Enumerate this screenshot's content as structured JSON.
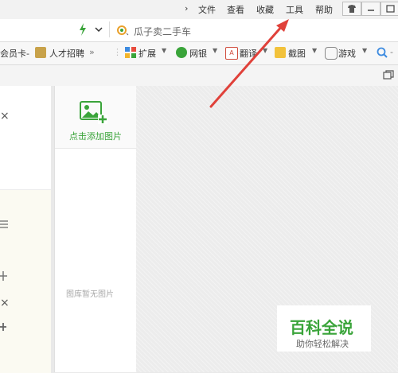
{
  "menu": {
    "items": [
      "文件",
      "查看",
      "收藏",
      "工具",
      "帮助"
    ]
  },
  "address": {
    "search_text": "瓜子卖二手车"
  },
  "bookmarks": [
    {
      "label": "会员卡-",
      "icon": "card-icon"
    },
    {
      "label": "人才招聘",
      "icon": "recruit-icon"
    },
    {
      "label": "扩展",
      "icon": "extension-icon"
    },
    {
      "label": "网银",
      "icon": "bank-shield-icon"
    },
    {
      "label": "翻译",
      "icon": "translate-icon"
    },
    {
      "label": "截图",
      "icon": "screenshot-icon"
    },
    {
      "label": "游戏",
      "icon": "game-icon"
    }
  ],
  "gallery": {
    "add_label": "点击添加图片",
    "empty_label": "图库暂无图片"
  },
  "watermark": {
    "title": "百科全说",
    "subtitle": "助你轻松解决"
  },
  "colors": {
    "accent_green": "#3aa43a",
    "arrow_red": "#e0413a"
  }
}
